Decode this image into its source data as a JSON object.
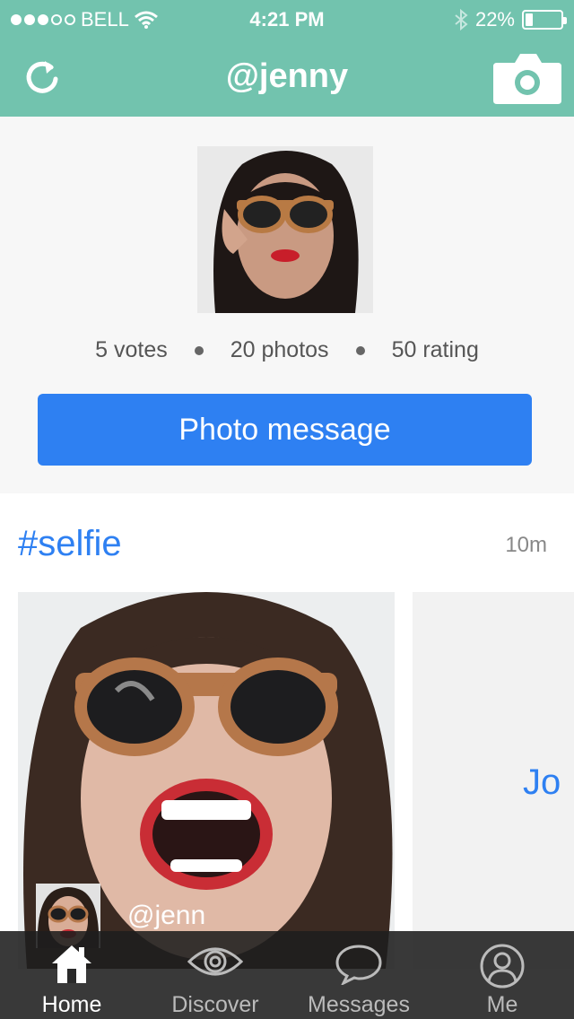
{
  "status_bar": {
    "carrier": "BELL",
    "time": "4:21 PM",
    "battery": "22%",
    "battery_level": 0.22,
    "signal_bars": 3,
    "signal_total": 5
  },
  "nav": {
    "title": "@jenny",
    "refresh_icon": "refresh-icon",
    "camera_icon": "camera-icon"
  },
  "profile": {
    "votes": "5 votes",
    "photos": "20 photos",
    "rating": "50 rating",
    "photo_message_label": "Photo message"
  },
  "post": {
    "hashtag": "#selfie",
    "time": "10m",
    "username": "@jenn",
    "next_card_text": "Jo"
  },
  "tabs": [
    {
      "label": "Home",
      "icon": "home-icon",
      "active": true
    },
    {
      "label": "Discover",
      "icon": "eye-icon",
      "active": false
    },
    {
      "label": "Messages",
      "icon": "speech-bubble-icon",
      "active": false
    },
    {
      "label": "Me",
      "icon": "person-icon",
      "active": false
    }
  ],
  "colors": {
    "header": "#72c3ae",
    "accent": "#2e80f2"
  }
}
